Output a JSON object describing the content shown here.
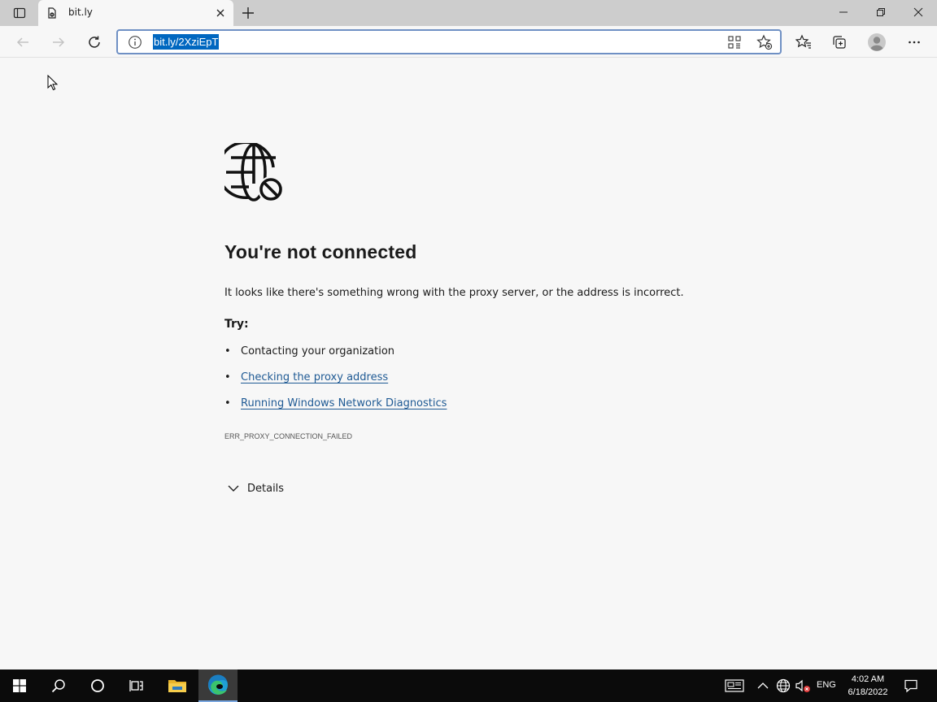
{
  "browser": {
    "tab": {
      "title": "bit.ly"
    },
    "address_bar": {
      "url": "bit.ly/2XziEpT"
    }
  },
  "error_page": {
    "title": "You're not connected",
    "description": "It looks like there's something wrong with the proxy server, or the address is incorrect.",
    "try_heading": "Try:",
    "suggestions": [
      {
        "text": "Contacting your organization",
        "is_link": false
      },
      {
        "text": "Checking the proxy address",
        "is_link": true
      },
      {
        "text": "Running Windows Network Diagnostics",
        "is_link": true
      }
    ],
    "error_code": "ERR_PROXY_CONNECTION_FAILED",
    "details_label": "Details"
  },
  "taskbar": {
    "language": "ENG",
    "time": "4:02 AM",
    "date": "6/18/2022"
  },
  "colors": {
    "accent": "#0067c0",
    "link": "#1f5a94",
    "page_bg": "#f7f7f7",
    "tabstrip_bg": "#cdcdcd",
    "taskbar_bg": "#0b0b0b"
  },
  "icons": [
    "tab-actions-icon",
    "page-favicon",
    "close-icon",
    "plus-icon",
    "minimize-icon",
    "restore-icon",
    "window-close-icon",
    "back-icon",
    "forward-icon",
    "refresh-icon",
    "info-icon",
    "apps-icon",
    "add-favorite-icon",
    "favorites-icon",
    "collections-icon",
    "profile-avatar",
    "more-icon",
    "globe-blocked-icon",
    "chevron-down-icon",
    "windows-start-icon",
    "search-icon",
    "cortana-icon",
    "task-view-icon",
    "file-explorer-icon",
    "edge-icon",
    "news-icon",
    "chevron-up-icon",
    "network-icon",
    "volume-muted-icon",
    "notifications-icon"
  ]
}
